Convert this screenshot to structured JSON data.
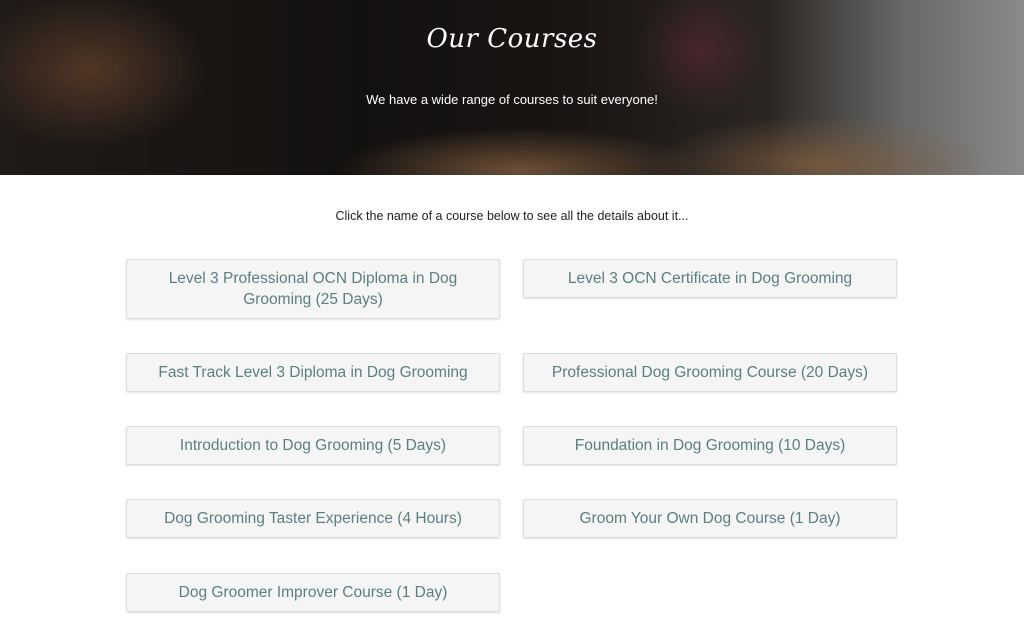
{
  "hero": {
    "title": "Our Courses",
    "subtitle": "We have a wide range of courses to suit everyone!"
  },
  "intro": "Click the name of a course below to see all the details about it...",
  "courses": [
    {
      "label": "Level 3 Professional OCN Diploma in Dog Grooming (25 Days)"
    },
    {
      "label": "Level 3 OCN Certificate in Dog Grooming"
    },
    {
      "label": "Fast Track Level 3 Diploma in Dog Grooming"
    },
    {
      "label": "Professional Dog Grooming Course (20 Days)"
    },
    {
      "label": "Introduction to Dog Grooming (5 Days)"
    },
    {
      "label": "Foundation in Dog Grooming (10 Days)"
    },
    {
      "label": "Dog Grooming Taster Experience (4 Hours)"
    },
    {
      "label": "Groom Your Own Dog Course (1 Day)"
    },
    {
      "label": "Dog Groomer Improver Course (1 Day)"
    }
  ],
  "colors": {
    "button_text": "#5b7f80",
    "button_bg": "#f5f5f5",
    "button_border": "#dcdcdc",
    "intro_text": "#222222"
  }
}
